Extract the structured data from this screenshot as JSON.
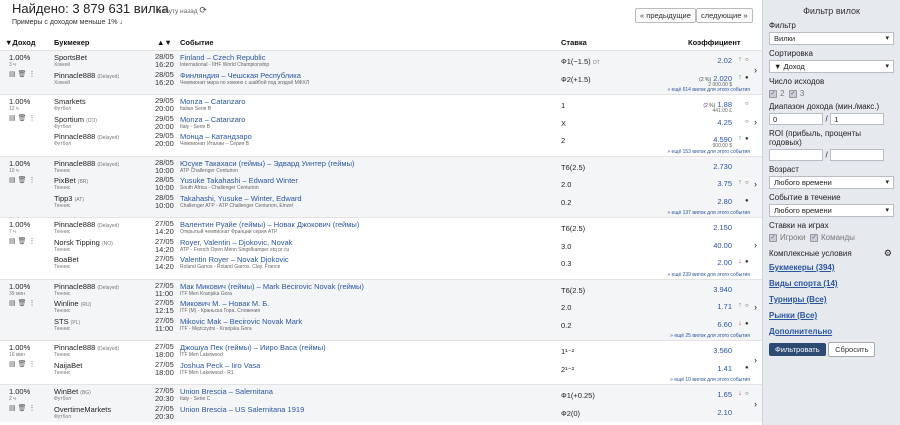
{
  "header": {
    "title": "Найдено: 3 879 631 вилка",
    "updated": "минуту назад",
    "subtitle": "Примеры с доходом меньше 1% ↓",
    "prev": "« предыдущие",
    "next": "следующие »"
  },
  "columns": {
    "income": "▼Доход",
    "bookmaker": "Букмекер",
    "sort": "▲▼",
    "event": "Событие",
    "bet": "Ставка",
    "coef": "Коэффициент"
  },
  "arbs": [
    {
      "pct": "1.00%",
      "time": "3 ч",
      "more": "» ещё 614 вилок для этого события",
      "bets": [
        {
          "bk": "SportsBet",
          "bksfx": "",
          "sport": "Хоккей",
          "date": "28/05",
          "tm": "16:20",
          "ev": "Finland – Czech Republic",
          "evs": "International - IIHF World Championship",
          "st": "Ф1(−1.5)",
          "stsfx": "ОТ",
          "cf": "2.02",
          "cfs": "",
          "chg": "",
          "ar": "up",
          "mk": "○"
        },
        {
          "bk": "Pinnacle888",
          "bksfx": "(Delayed)",
          "sport": "Хоккей",
          "date": "28/05",
          "tm": "16:20",
          "ev": "Финляндия – Чешская Республика",
          "evs": "Чемпионат мира по хоккею с шайбой под эгидой МФХЛ",
          "st": "Ф2(+1.5)",
          "stsfx": "",
          "cf": "2.020",
          "cfs": "2 000.00 $",
          "chg": "(2 %)",
          "ar": "up",
          "mk": "●"
        }
      ]
    },
    {
      "pct": "1.00%",
      "time": "12 ч",
      "more": "» ещё 153 вилок для этого события",
      "bets": [
        {
          "bk": "Smarkets",
          "bksfx": "",
          "sport": "Футбол",
          "date": "29/05",
          "tm": "20:00",
          "ev": "Monza – Catanzaro",
          "evs": "Italian Serie B",
          "st": "1",
          "stsfx": "",
          "cf": "1.88",
          "cfs": "441.00 £",
          "chg": "(2 %)",
          "ar": "",
          "mk": "○"
        },
        {
          "bk": "Sportium",
          "bksfx": "(CO)",
          "sport": "Футбол",
          "date": "29/05",
          "tm": "20:00",
          "ev": "Monza – Catanzaro",
          "evs": "Italy - Serie B",
          "st": "X",
          "stsfx": "",
          "cf": "4.25",
          "cfs": "",
          "chg": "",
          "ar": "",
          "mk": "○"
        },
        {
          "bk": "Pinnacle888",
          "bksfx": "(Delayed)",
          "sport": "Футбол",
          "date": "29/05",
          "tm": "20:00",
          "ev": "Монца – Катандзаро",
          "evs": "Чемпионат Италии – Серия B",
          "st": "2",
          "stsfx": "",
          "cf": "4.590",
          "cfs": "900.00 $",
          "chg": "",
          "ar": "up",
          "mk": "●"
        }
      ]
    },
    {
      "pct": "1.00%",
      "time": "10 ч",
      "more": "» ещё 137 вилок для этого события",
      "bets": [
        {
          "bk": "Pinnacle888",
          "bksfx": "(Delayed)",
          "sport": "Теннис",
          "date": "28/05",
          "tm": "10:00",
          "ev": "Юсуке Такахаси (геймы) – Эдвард Уинтер (геймы)",
          "evs": "ATP Challenger Centurion",
          "st": "Т6(2.5)",
          "stsfx": "",
          "cf": "2.730",
          "cfs": "",
          "chg": "",
          "ar": "",
          "mk": ""
        },
        {
          "bk": "PixBet",
          "bksfx": "(BR)",
          "sport": "Теннис",
          "date": "28/05",
          "tm": "10:00",
          "ev": "Yusuke Takahashi – Edward Winter",
          "evs": "South Africa - Challenger Centurion",
          "st": "2.0",
          "stsfx": "",
          "cf": "3.75",
          "cfs": "",
          "chg": "",
          "ar": "up",
          "mk": "○"
        },
        {
          "bk": "Tipp3",
          "bksfx": "(AT)",
          "sport": "Теннис",
          "date": "28/05",
          "tm": "10:00",
          "ev": "Takahashi, Yusuke – Winter, Edward",
          "evs": "Challenger ATP - ATP Challenger Centurion, Einzel",
          "st": "0.2",
          "stsfx": "",
          "cf": "2.80",
          "cfs": "",
          "chg": "",
          "ar": "",
          "mk": "●"
        }
      ]
    },
    {
      "pct": "1.00%",
      "time": "7 ч",
      "more": "» ещё 239 вилок для этого события",
      "bets": [
        {
          "bk": "Pinnacle888",
          "bksfx": "(Delayed)",
          "sport": "Теннис",
          "date": "27/05",
          "tm": "14:20",
          "ev": "Валентин Руайе (геймы) – Новак Джокович (геймы)",
          "evs": "Открытый чемпионат Франции серия ATP",
          "st": "Т6(2.5)",
          "stsfx": "",
          "cf": "2.150",
          "cfs": "",
          "chg": "",
          "ar": "",
          "mk": ""
        },
        {
          "bk": "Norsk Tipping",
          "bksfx": "(NO)",
          "sport": "Теннис",
          "date": "27/05",
          "tm": "14:20",
          "ev": "Royer, Valentin – Djokovic, Novak",
          "evs": "ATP - French Open Menn Singelkamper stq pr cu",
          "st": "3.0",
          "stsfx": "",
          "cf": "40.00",
          "cfs": "",
          "chg": "",
          "ar": "",
          "mk": ""
        },
        {
          "bk": "BoaBet",
          "bksfx": "",
          "sport": "Теннис",
          "date": "27/05",
          "tm": "14:20",
          "ev": "Valentin Royer – Novak Djokovic",
          "evs": "Roland Garros - Roland Garros. Clay. France",
          "st": "0.3",
          "stsfx": "",
          "cf": "2.00",
          "cfs": "",
          "chg": "",
          "ar": "dn",
          "mk": "●"
        }
      ]
    },
    {
      "pct": "1.00%",
      "time": "39 мин",
      "more": "» ещё 25 вилок для этого события",
      "bets": [
        {
          "bk": "Pinnacle888",
          "bksfx": "(Delayed)",
          "sport": "Теннис",
          "date": "27/05",
          "tm": "11:00",
          "ev": "Мак Микович (геймы) – Mark Becirovic Novak (геймы)",
          "evs": "ITF Men Kranjska Gora",
          "st": "Т6(2.5)",
          "stsfx": "",
          "cf": "3.940",
          "cfs": "",
          "chg": "",
          "ar": "",
          "mk": ""
        },
        {
          "bk": "Winline",
          "bksfx": "(RU)",
          "sport": "Теннис",
          "date": "27/05",
          "tm": "12:15",
          "ev": "Микович М. – Новак М. Б.",
          "evs": "ITF (M) - Краньска Гора. Словения",
          "st": "2.0",
          "stsfx": "",
          "cf": "1.71",
          "cfs": "",
          "chg": "",
          "ar": "up",
          "mk": "○"
        },
        {
          "bk": "STS",
          "bksfx": "(PL)",
          "sport": "Теннис",
          "date": "27/05",
          "tm": "11:00",
          "ev": "Mikovic Mak – Becirovic Novak Mark",
          "evs": "ITF - Mężczyźni - Kranjska Gora",
          "st": "0.2",
          "stsfx": "",
          "cf": "6.60",
          "cfs": "",
          "chg": "",
          "ar": "dn",
          "mk": "●"
        }
      ]
    },
    {
      "pct": "1.00%",
      "time": "16 мин",
      "more": "» ещё 10 вилок для этого события",
      "bets": [
        {
          "bk": "Pinnacle888",
          "bksfx": "(Delayed)",
          "sport": "Теннис",
          "date": "27/05",
          "tm": "18:00",
          "ev": "Джошуа Пек (геймы) – Ииро Васа (геймы)",
          "evs": "ITF Men Lakewood",
          "st": "1¹⁻²",
          "stsfx": "",
          "cf": "3.560",
          "cfs": "",
          "chg": "",
          "ar": "",
          "mk": ""
        },
        {
          "bk": "NaijaBet",
          "bksfx": "",
          "sport": "Теннис",
          "date": "27/05",
          "tm": "18:00",
          "ev": "Joshua Peck – Iiro Vasa",
          "evs": "ITF Men Lakewood - R1",
          "st": "2¹⁻²",
          "stsfx": "",
          "cf": "1.41",
          "cfs": "",
          "chg": "",
          "ar": "",
          "mk": "●"
        }
      ]
    },
    {
      "pct": "1.00%",
      "time": "2 ч",
      "more": "",
      "bets": [
        {
          "bk": "WinBet",
          "bksfx": "(BG)",
          "sport": "Футбол",
          "date": "27/05",
          "tm": "20:30",
          "ev": "Union Brescia – Salernitana",
          "evs": "Italy - Serie C",
          "st": "Ф1(+0.25)",
          "stsfx": "",
          "cf": "1.65",
          "cfs": "",
          "chg": "",
          "ar": "dn",
          "mk": "○"
        },
        {
          "bk": "OvertimeMarkets",
          "bksfx": "",
          "sport": "Футбол",
          "date": "27/05",
          "tm": "20:30",
          "ev": "Union Brescia – US Salernitana 1919",
          "evs": "",
          "st": "Ф2(0)",
          "stsfx": "",
          "cf": "2.10",
          "cfs": "",
          "chg": "",
          "ar": "",
          "mk": ""
        }
      ]
    }
  ],
  "sidebar": {
    "title": "Фильтр вилок",
    "filter_label": "Фильтр",
    "filter_value": "Вилки",
    "sort_label": "Сортировка",
    "sort_value": "▼ Доход",
    "outcomes_label": "Число исходов",
    "outcome_2": "2",
    "outcome_3": "3",
    "income_label": "Диапазон дохода (мин./макс.)",
    "income_min": "0",
    "income_max": "1",
    "roi_label": "ROI (прибыль, проценты годовых)",
    "age_label": "Возраст",
    "age_value": "Любого времени",
    "event_label": "Событие в течение",
    "event_value": "Любого времени",
    "games_label": "Ставки на играх",
    "games_players": "Игроки",
    "games_teams": "Команды",
    "complex_label": "Комплексные условия",
    "link_bk": "Букмекеры (394)",
    "link_sport": "Виды спорта (14)",
    "link_tour": "Турниры (Все)",
    "link_market": "Рынки (Все)",
    "link_extra": "Дополнительно",
    "filter_btn": "Фильтровать",
    "reset_btn": "Сбросить"
  }
}
